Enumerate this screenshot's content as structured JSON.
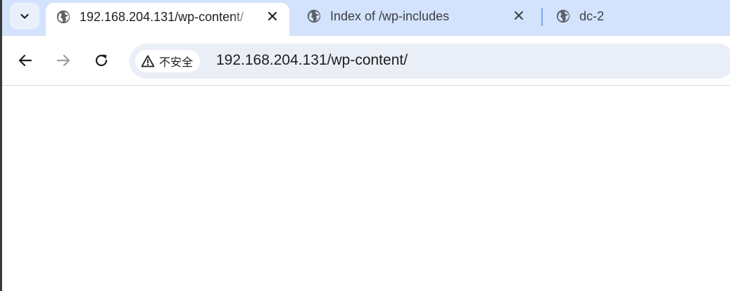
{
  "tabs": [
    {
      "title": "192.168.204.131/wp-content/",
      "active": true,
      "closable": true
    },
    {
      "title": "Index of /wp-includes",
      "active": false,
      "closable": true
    },
    {
      "title": "dc-2",
      "active": false,
      "closable": false
    }
  ],
  "toolbar": {
    "security_label": "不安全",
    "url": "192.168.204.131/wp-content/"
  },
  "icons": {
    "tab_search": "chevron-down-icon",
    "favicon": "globe-icon",
    "close": "close-icon",
    "back": "arrow-left-icon",
    "forward": "arrow-right-icon",
    "reload": "reload-icon",
    "security": "warning-triangle-icon"
  },
  "colors": {
    "tabstrip": "#d3e3fd",
    "omnibox": "#eaeef7",
    "forward_disabled": "#9aa0a6"
  }
}
